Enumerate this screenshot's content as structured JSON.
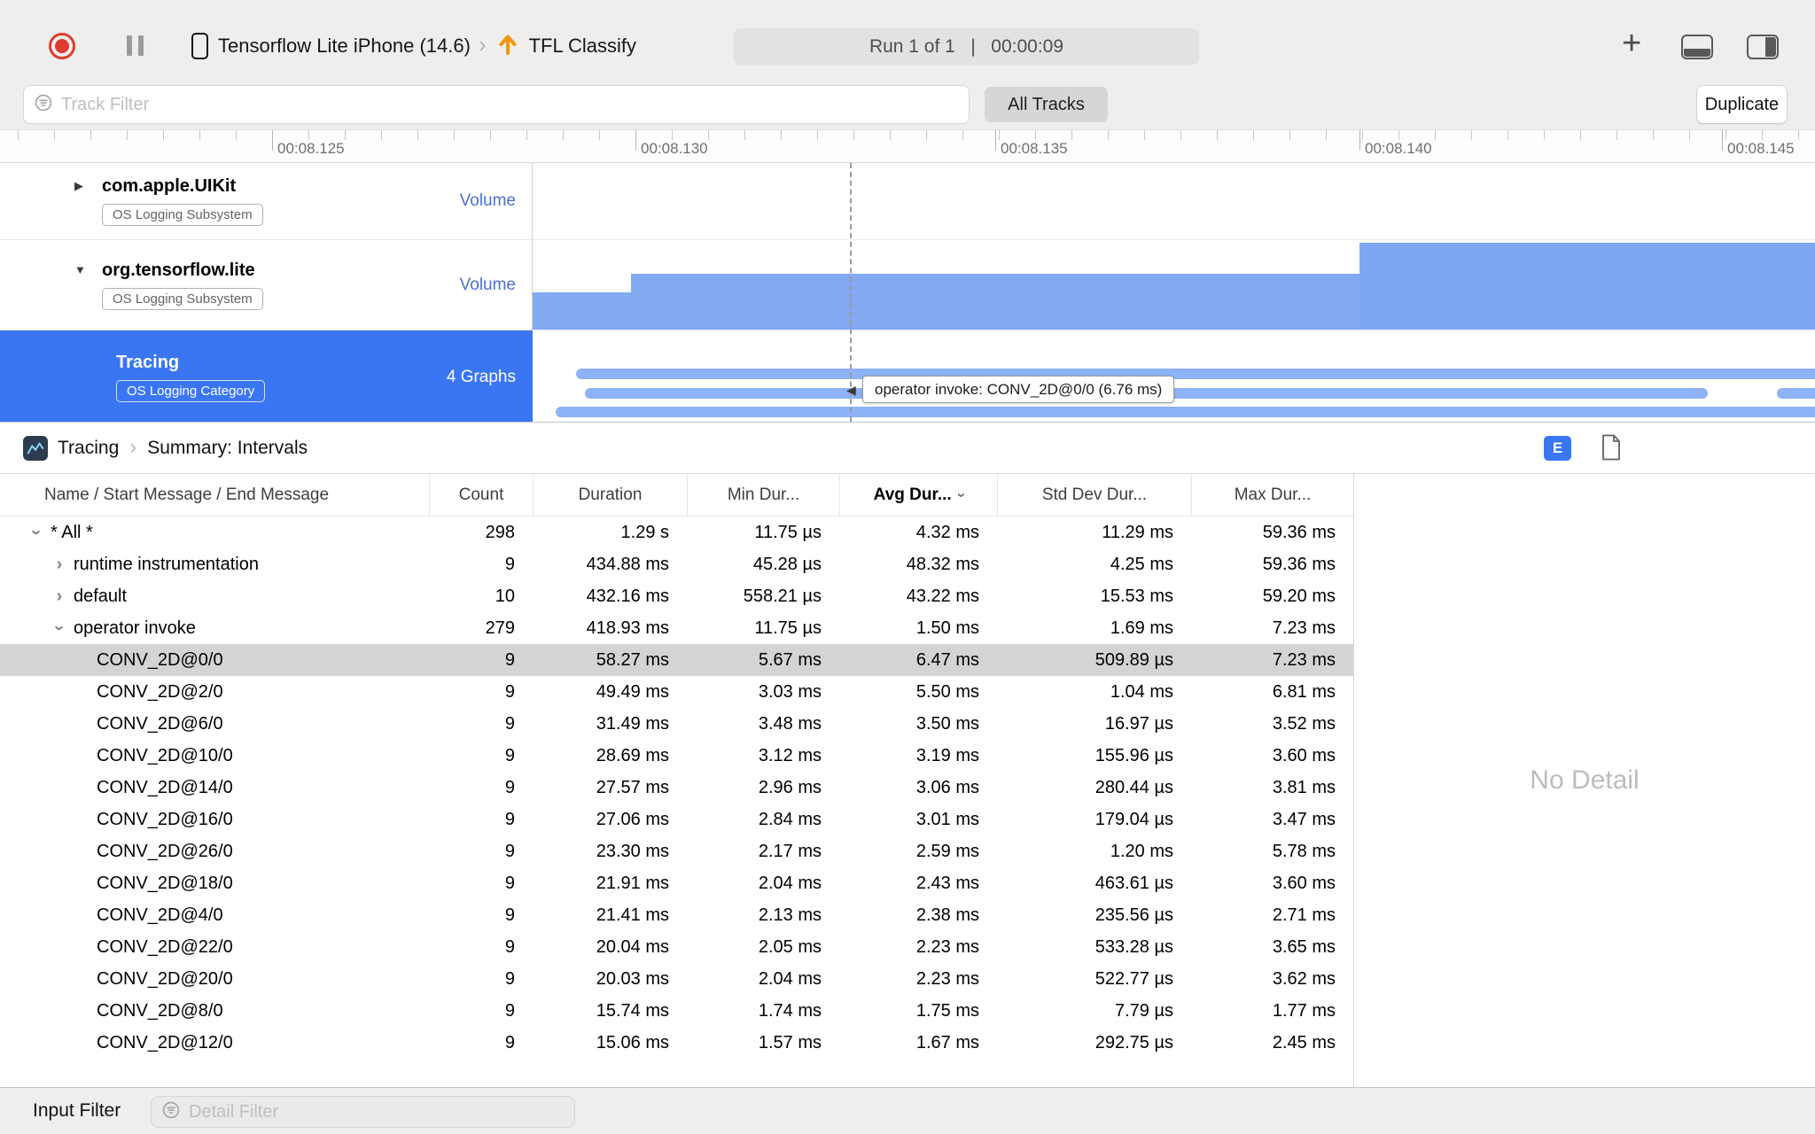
{
  "toolbar": {
    "device_name": "Tensorflow Lite iPhone (14.6)",
    "target_name": "TFL Classify",
    "run_status": "Run 1 of 1   |   00:00:09"
  },
  "filter_bar": {
    "track_filter_placeholder": "Track Filter",
    "all_tracks_label": "All Tracks",
    "duplicate_label": "Duplicate"
  },
  "ruler": {
    "labels": [
      "00:08.125",
      "00:08.130",
      "00:08.135",
      "00:08.140",
      "00:08.145"
    ]
  },
  "tracks": [
    {
      "title": "com.apple.UIKit",
      "badge": "OS Logging Subsystem",
      "meta": "Volume"
    },
    {
      "title": "org.tensorflow.lite",
      "badge": "OS Logging Subsystem",
      "meta": "Volume"
    },
    {
      "title": "Tracing",
      "badge": "OS Logging Category",
      "meta": "4 Graphs"
    }
  ],
  "plot_tooltip": {
    "text": "operator invoke: CONV_2D@0/0 (6.76 ms)"
  },
  "detail_header": {
    "breadcrumb_root": "Tracing",
    "breadcrumb_leaf": "Summary: Intervals",
    "extended_detail_button": "E"
  },
  "table": {
    "columns": [
      "Name / Start Message / End Message",
      "Count",
      "Duration",
      "Min Dur...",
      "Avg Dur...",
      "Std Dev Dur...",
      "Max Dur..."
    ],
    "rows": [
      {
        "name": "* All *",
        "count": "298",
        "duration": "1.29 s",
        "min": "11.75 µs",
        "avg": "4.32 ms",
        "stddev": "11.29 ms",
        "max": "59.36 ms",
        "depth": 0,
        "disclosure": "down",
        "selected": false
      },
      {
        "name": "runtime instrumentation",
        "count": "9",
        "duration": "434.88 ms",
        "min": "45.28 µs",
        "avg": "48.32 ms",
        "stddev": "4.25 ms",
        "max": "59.36 ms",
        "depth": 1,
        "disclosure": "right",
        "selected": false
      },
      {
        "name": "default",
        "count": "10",
        "duration": "432.16 ms",
        "min": "558.21 µs",
        "avg": "43.22 ms",
        "stddev": "15.53 ms",
        "max": "59.20 ms",
        "depth": 1,
        "disclosure": "right",
        "selected": false
      },
      {
        "name": "operator invoke",
        "count": "279",
        "duration": "418.93 ms",
        "min": "11.75 µs",
        "avg": "1.50 ms",
        "stddev": "1.69 ms",
        "max": "7.23 ms",
        "depth": 1,
        "disclosure": "down",
        "selected": false
      },
      {
        "name": "CONV_2D@0/0",
        "count": "9",
        "duration": "58.27 ms",
        "min": "5.67 ms",
        "avg": "6.47 ms",
        "stddev": "509.89 µs",
        "max": "7.23 ms",
        "depth": 2,
        "disclosure": "none",
        "selected": true
      },
      {
        "name": "CONV_2D@2/0",
        "count": "9",
        "duration": "49.49 ms",
        "min": "3.03 ms",
        "avg": "5.50 ms",
        "stddev": "1.04 ms",
        "max": "6.81 ms",
        "depth": 2,
        "disclosure": "none",
        "selected": false
      },
      {
        "name": "CONV_2D@6/0",
        "count": "9",
        "duration": "31.49 ms",
        "min": "3.48 ms",
        "avg": "3.50 ms",
        "stddev": "16.97 µs",
        "max": "3.52 ms",
        "depth": 2,
        "disclosure": "none",
        "selected": false
      },
      {
        "name": "CONV_2D@10/0",
        "count": "9",
        "duration": "28.69 ms",
        "min": "3.12 ms",
        "avg": "3.19 ms",
        "stddev": "155.96 µs",
        "max": "3.60 ms",
        "depth": 2,
        "disclosure": "none",
        "selected": false
      },
      {
        "name": "CONV_2D@14/0",
        "count": "9",
        "duration": "27.57 ms",
        "min": "2.96 ms",
        "avg": "3.06 ms",
        "stddev": "280.44 µs",
        "max": "3.81 ms",
        "depth": 2,
        "disclosure": "none",
        "selected": false
      },
      {
        "name": "CONV_2D@16/0",
        "count": "9",
        "duration": "27.06 ms",
        "min": "2.84 ms",
        "avg": "3.01 ms",
        "stddev": "179.04 µs",
        "max": "3.47 ms",
        "depth": 2,
        "disclosure": "none",
        "selected": false
      },
      {
        "name": "CONV_2D@26/0",
        "count": "9",
        "duration": "23.30 ms",
        "min": "2.17 ms",
        "avg": "2.59 ms",
        "stddev": "1.20 ms",
        "max": "5.78 ms",
        "depth": 2,
        "disclosure": "none",
        "selected": false
      },
      {
        "name": "CONV_2D@18/0",
        "count": "9",
        "duration": "21.91 ms",
        "min": "2.04 ms",
        "avg": "2.43 ms",
        "stddev": "463.61 µs",
        "max": "3.60 ms",
        "depth": 2,
        "disclosure": "none",
        "selected": false
      },
      {
        "name": "CONV_2D@4/0",
        "count": "9",
        "duration": "21.41 ms",
        "min": "2.13 ms",
        "avg": "2.38 ms",
        "stddev": "235.56 µs",
        "max": "2.71 ms",
        "depth": 2,
        "disclosure": "none",
        "selected": false
      },
      {
        "name": "CONV_2D@22/0",
        "count": "9",
        "duration": "20.04 ms",
        "min": "2.05 ms",
        "avg": "2.23 ms",
        "stddev": "533.28 µs",
        "max": "3.65 ms",
        "depth": 2,
        "disclosure": "none",
        "selected": false
      },
      {
        "name": "CONV_2D@20/0",
        "count": "9",
        "duration": "20.03 ms",
        "min": "2.04 ms",
        "avg": "2.23 ms",
        "stddev": "522.77 µs",
        "max": "3.62 ms",
        "depth": 2,
        "disclosure": "none",
        "selected": false
      },
      {
        "name": "CONV_2D@8/0",
        "count": "9",
        "duration": "15.74 ms",
        "min": "1.74 ms",
        "avg": "1.75 ms",
        "stddev": "7.79 µs",
        "max": "1.77 ms",
        "depth": 2,
        "disclosure": "none",
        "selected": false
      },
      {
        "name": "CONV_2D@12/0",
        "count": "9",
        "duration": "15.06 ms",
        "min": "1.57 ms",
        "avg": "1.67 ms",
        "stddev": "292.75 µs",
        "max": "2.45 ms",
        "depth": 2,
        "disclosure": "none",
        "selected": false
      }
    ]
  },
  "detail_panel": {
    "empty_text": "No Detail"
  },
  "bottom_bar": {
    "label": "Input Filter",
    "detail_filter_placeholder": "Detail Filter"
  }
}
